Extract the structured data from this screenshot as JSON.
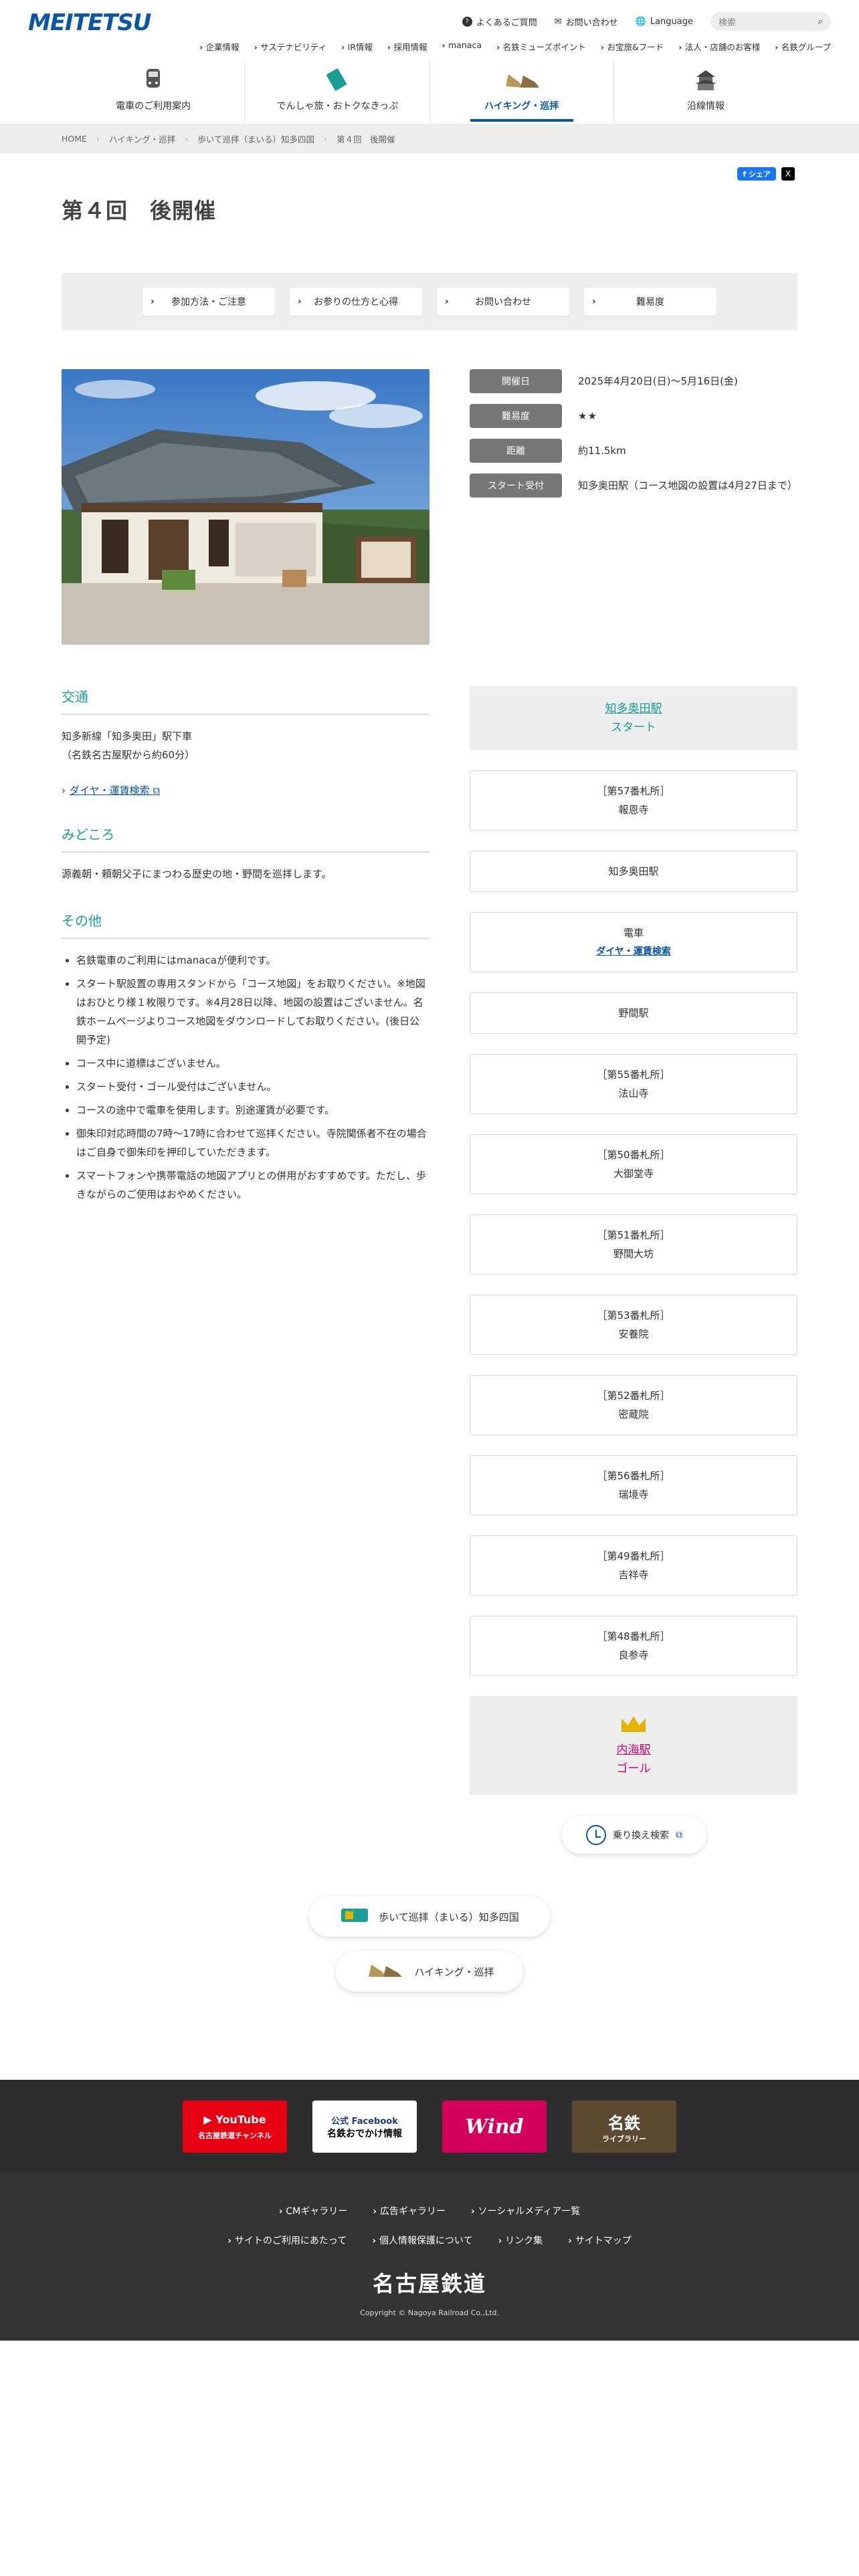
{
  "header": {
    "logo_text": "MEITETSU",
    "utility": {
      "faq": "よくあるご質問",
      "contact": "お問い合わせ",
      "language": "Language",
      "search_placeholder": "検索"
    },
    "subnav": [
      "企業情報",
      "サステナビリティ",
      "IR情報",
      "採用情報",
      "manaca",
      "名鉄ミューズポイント",
      "お宝旅&フード",
      "法人・店舗のお客様",
      "名鉄グループ"
    ],
    "mainnav": [
      "電車のご利用案内",
      "でんしゃ旅・おトクなきっぷ",
      "ハイキング・巡拝",
      "沿線情報"
    ]
  },
  "breadcrumb": [
    "HOME",
    "ハイキング・巡拝",
    "歩いて巡拝（まいる）知多四国",
    "第４回　後開催"
  ],
  "share": {
    "facebook": "シェア",
    "x": "X"
  },
  "page_title": "第４回　後開催",
  "anchors": [
    "参加方法・ご注意",
    "お参りの仕方と心得",
    "お問い合わせ",
    "難易度"
  ],
  "info": {
    "date_label": "開催日",
    "date_value": "2025年4月20日(日)～5月16日(金)",
    "difficulty_label": "難易度",
    "difficulty_value": "★★",
    "distance_label": "距離",
    "distance_value": "約11.5km",
    "start_label": "スタート受付",
    "start_value": "知多奥田駅（コース地図の設置は4月27日まで）"
  },
  "access": {
    "heading": "交通",
    "line1": "知多新線「知多奥田」駅下車",
    "line2": "（名鉄名古屋駅から約60分）",
    "link": "ダイヤ・運賃検索"
  },
  "highlight": {
    "heading": "みどころ",
    "text": "源義朝・頼朝父子にまつわる歴史の地・野間を巡拝します。"
  },
  "other": {
    "heading": "その他",
    "items": [
      "名鉄電車のご利用にはmanacaが便利です。",
      "スタート駅設置の専用スタンドから「コース地図」をお取りください。※地図はおひとり様１枚限りです。※4月28日以降、地図の設置はございません。名鉄ホームページよりコース地図をダウンロードしてお取りください。(後日公開予定)",
      "コース中に道標はございません。",
      "スタート受付・ゴール受付はございません。",
      "コースの途中で電車を使用します。別途運賃が必要です。",
      "御朱印対応時間の7時〜17時に合わせて巡拝ください。寺院関係者不在の場合はご自身で御朱印を押印していただきます。",
      "スマートフォンや携帯電話の地図アプリとの併用がおすすめです。ただし、歩きながらのご使用はおやめください。"
    ]
  },
  "route": {
    "start_station": "知多奥田駅",
    "start_label": "スタート",
    "stops": [
      {
        "l1": "［第57番札所］",
        "l2": "報恩寺"
      },
      {
        "l1": "知多奥田駅",
        "l2": ""
      },
      {
        "l1": "電車",
        "l2": "ダイヤ・運賃検索",
        "link": true
      },
      {
        "l1": "野間駅",
        "l2": ""
      },
      {
        "l1": "［第55番札所］",
        "l2": "法山寺"
      },
      {
        "l1": "［第50番札所］",
        "l2": "大御堂寺"
      },
      {
        "l1": "［第51番札所］",
        "l2": "野間大坊"
      },
      {
        "l1": "［第53番札所］",
        "l2": "安養院"
      },
      {
        "l1": "［第52番札所］",
        "l2": "密蔵院"
      },
      {
        "l1": "［第56番札所］",
        "l2": "瑞境寺"
      },
      {
        "l1": "［第49番札所］",
        "l2": "吉祥寺"
      },
      {
        "l1": "［第48番札所］",
        "l2": "良参寺"
      }
    ],
    "goal_station": "内海駅",
    "goal_label": "ゴール",
    "transfer_button": "乗り換え検索"
  },
  "bottom_links": {
    "pilgrimage": "歩いて巡拝（まいる）知多四国",
    "hiking": "ハイキング・巡拝"
  },
  "footer": {
    "banners": {
      "youtube_title": "YouTube",
      "youtube_sub": "名古屋鉄道チャンネル",
      "facebook_title": "公式 Facebook",
      "facebook_sub": "名鉄おでかけ情報",
      "wind_title": "Wind",
      "library_title": "名鉄",
      "library_sub": "ライブラリー"
    },
    "links1": [
      "CMギャラリー",
      "広告ギャラリー",
      "ソーシャルメディア一覧"
    ],
    "links2": [
      "サイトのご利用にあたって",
      "個人情報保護について",
      "リンク集",
      "サイトマップ"
    ],
    "company": "名古屋鉄道",
    "copyright": "Copyright © Nagoya Railroad Co.,Ltd."
  },
  "colors": {
    "brand_blue": "#0a56a3",
    "teal": "#1a9e96",
    "goal_pink": "#d4006e",
    "star": "#e6b400"
  }
}
